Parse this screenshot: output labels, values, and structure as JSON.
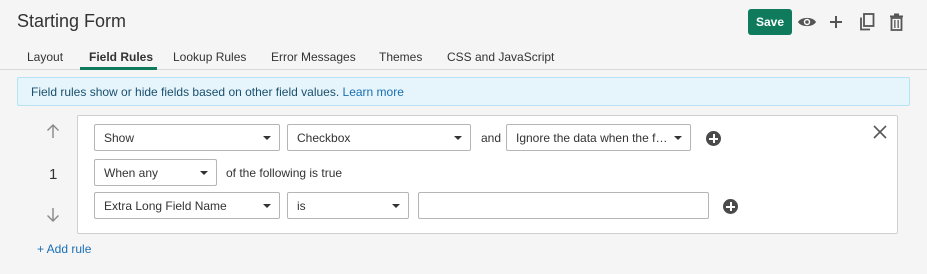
{
  "header": {
    "title": "Starting Form",
    "save_label": "Save",
    "icons": [
      "eye-icon",
      "plus-icon",
      "copy-icon",
      "trash-icon"
    ]
  },
  "tabs": [
    {
      "label": "Layout",
      "active": false
    },
    {
      "label": "Field Rules",
      "active": true
    },
    {
      "label": "Lookup Rules",
      "active": false
    },
    {
      "label": "Error Messages",
      "active": false
    },
    {
      "label": "Themes",
      "active": false
    },
    {
      "label": "CSS and JavaScript",
      "active": false
    }
  ],
  "info": {
    "text": "Field rules show or hide fields based on other field values.",
    "link": "Learn more"
  },
  "rule": {
    "number": "1",
    "action": "Show",
    "field": "Checkbox",
    "and_label": "and",
    "data_option": "Ignore the data when the fie...",
    "match": "When any",
    "match_suffix": "of the following is true",
    "condition": {
      "field": "Extra Long Field Name",
      "operator": "is",
      "value": ""
    }
  },
  "add_rule_label": "+ Add rule",
  "colors": {
    "accent": "#0f7b5c",
    "info_bg": "#e5f5fb",
    "link": "#1a6fb3"
  }
}
